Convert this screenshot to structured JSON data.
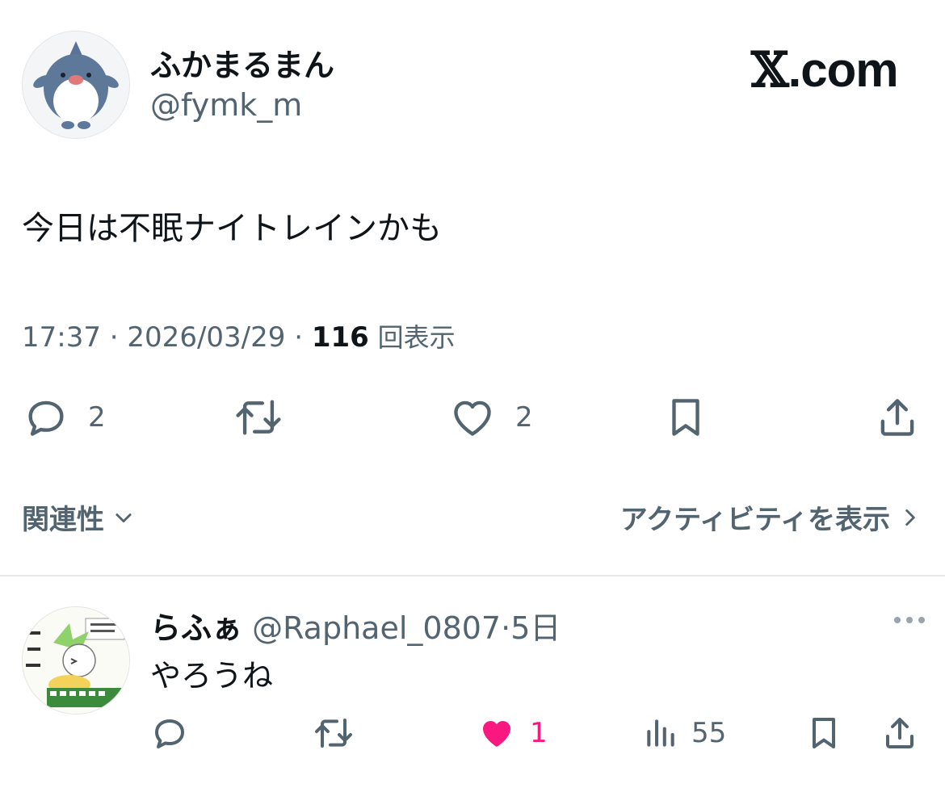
{
  "author": {
    "name": "ふかまるまん",
    "handle": "@fymk_m"
  },
  "brand": {
    "x": "𝕏",
    "rest": ".com"
  },
  "tweet": {
    "text": "今日は不眠ナイトレインかも",
    "time": "17:37",
    "sep1": " · ",
    "date": "2026/03/29",
    "sep2": " · ",
    "views": "116",
    "views_label": "回表示"
  },
  "actions": {
    "reply_count": "2",
    "like_count": "2"
  },
  "links": {
    "related": "関連性",
    "activity": "アクティビティを表示"
  },
  "reply": {
    "name": "らふぁ",
    "handle": "@Raphael_0807",
    "time": "·5日",
    "text": "やろうね",
    "like_count": "1",
    "view_count": "55"
  },
  "colors": {
    "like_active": "#f91880",
    "secondary_text": "#536471",
    "text": "#0f1419"
  }
}
